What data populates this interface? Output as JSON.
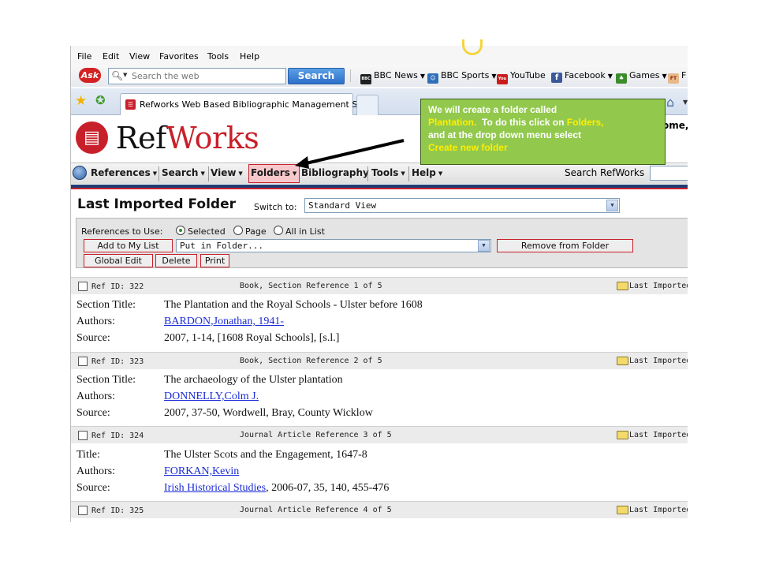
{
  "menu": [
    "File",
    "Edit",
    "View",
    "Favorites",
    "Tools",
    "Help"
  ],
  "toolbar": {
    "ask_logo": "Ask",
    "search_placeholder": "Search the web",
    "search_button": "Search",
    "bookmarks": [
      {
        "label": "BBC News",
        "icon": "bbc-icon",
        "color": "#1f1f1f",
        "glyph": "BBC"
      },
      {
        "label": "BBC Sports",
        "icon": "bbc-sports-icon",
        "color": "#2e6fb8",
        "glyph": "☺"
      },
      {
        "label": "YouTube",
        "icon": "youtube-icon",
        "color": "#cc1b1b",
        "glyph": "You"
      },
      {
        "label": "Facebook",
        "icon": "facebook-icon",
        "color": "#3b5998",
        "glyph": "f"
      },
      {
        "label": "Games",
        "icon": "games-icon",
        "color": "#3b8c2a",
        "glyph": "♣"
      },
      {
        "label": "F",
        "icon": "ft-icon",
        "color": "#e8b88a",
        "glyph": "FT"
      }
    ]
  },
  "tab": {
    "title": "Refworks Web Based Bibliographic Management Soft..."
  },
  "app": {
    "logo_ref": "Ref",
    "logo_works": "Works",
    "welcome": "ome,",
    "nav": [
      "References",
      "Search",
      "View",
      "Folders",
      "Bibliography",
      "Tools",
      "Help"
    ],
    "search_label": "Search RefWorks"
  },
  "folder": {
    "title": "Last Imported Folder",
    "switch_label": "Switch to:",
    "view_value": "Standard View",
    "refs_label": "References to Use:",
    "radios": [
      "Selected",
      "Page",
      "All in List"
    ],
    "buttons": {
      "add_to_list": "Add to My List",
      "put_in_folder": "Put in Folder...",
      "remove_from_folder": "Remove from Folder",
      "global_edit": "Global Edit",
      "delete": "Delete",
      "print": "Print"
    }
  },
  "references": [
    {
      "id": "Ref ID: 322",
      "type": "Book, Section Reference 1 of 5",
      "folder": "Last Imported",
      "rows": [
        {
          "label": "Section Title:",
          "value": "The Plantation and the Royal Schools - Ulster before 1608",
          "link": false
        },
        {
          "label": "Authors:",
          "value": "BARDON,Jonathan, 1941-",
          "link": true
        },
        {
          "label": "Source:",
          "value": "2007, 1-14, [1608 Royal Schools], [s.l.]",
          "link": false
        }
      ]
    },
    {
      "id": "Ref ID: 323",
      "type": "Book, Section Reference 2 of 5",
      "folder": "Last Imported",
      "rows": [
        {
          "label": "Section Title:",
          "value": "The archaeology of the Ulster plantation",
          "link": false
        },
        {
          "label": "Authors:",
          "value": "DONNELLY,Colm J.",
          "link": true
        },
        {
          "label": "Source:",
          "value": "2007, 37-50, Wordwell, Bray, County Wicklow",
          "link": false
        }
      ]
    },
    {
      "id": "Ref ID: 324",
      "type": "Journal Article Reference 3 of 5",
      "folder": "Last Imported",
      "rows": [
        {
          "label": "Title:",
          "value": "The Ulster Scots and the Engagement, 1647-8",
          "link": false
        },
        {
          "label": "Authors:",
          "value": "FORKAN,Kevin",
          "link": true
        },
        {
          "label": "Source:",
          "value": "Irish Historical Studies",
          "link": true,
          "suffix": ", 2006-07, 35, 140, 455-476"
        }
      ]
    },
    {
      "id": "Ref ID: 325",
      "type": "Journal Article Reference 4 of 5",
      "folder": "Last Imported",
      "rows": []
    }
  ],
  "callout": {
    "line1": "We will create a folder called",
    "line2a": "Plantation.",
    "line2b": "  To do this click on ",
    "line2c": "Folders,",
    "line3": "and at the drop down menu  select",
    "line4": "Create new folder"
  },
  "colors": {
    "brand_red": "#c8202a",
    "navy": "#1f3b73",
    "callout_green": "#92c94d",
    "callout_highlight": "#ffee00",
    "link_blue": "#1a2bd6"
  }
}
